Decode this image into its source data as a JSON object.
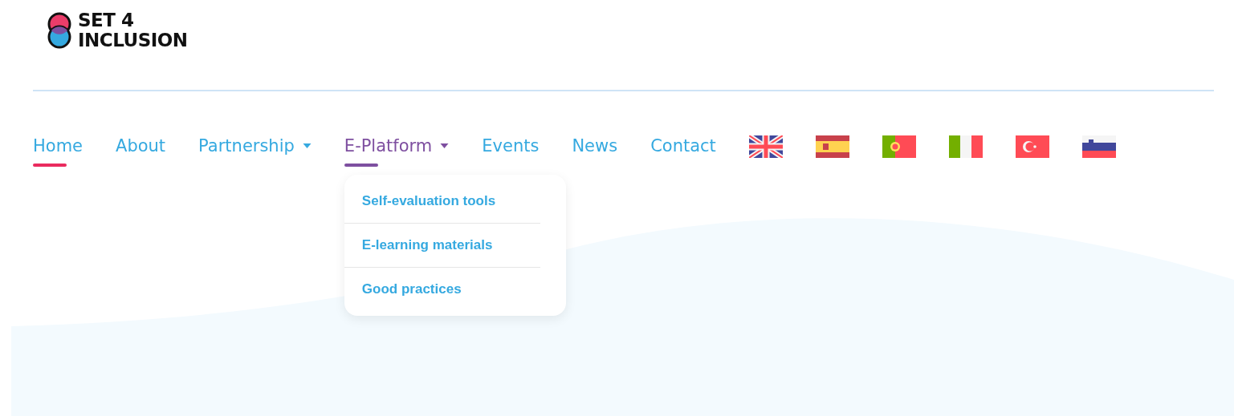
{
  "logo": {
    "lines": [
      "SET 4",
      "INCLUSION"
    ]
  },
  "nav": [
    {
      "label": "Home",
      "selected": true,
      "expanded": false,
      "has_menu": false
    },
    {
      "label": "About",
      "selected": false,
      "expanded": false,
      "has_menu": false
    },
    {
      "label": "Partnership",
      "selected": false,
      "expanded": false,
      "has_menu": true
    },
    {
      "label": "E-Platform",
      "selected": false,
      "expanded": true,
      "has_menu": true,
      "menu": [
        "Self-evaluation tools",
        "E-learning materials",
        "Good practices"
      ]
    },
    {
      "label": "Events",
      "selected": false,
      "expanded": false,
      "has_menu": false
    },
    {
      "label": "News",
      "selected": false,
      "expanded": false,
      "has_menu": false
    },
    {
      "label": "Contact",
      "selected": false,
      "expanded": false,
      "has_menu": false
    }
  ],
  "languages": [
    {
      "kind": "gb"
    },
    {
      "kind": "es"
    },
    {
      "kind": "pt"
    },
    {
      "kind": "it"
    },
    {
      "kind": "tr"
    },
    {
      "kind": "si"
    }
  ]
}
